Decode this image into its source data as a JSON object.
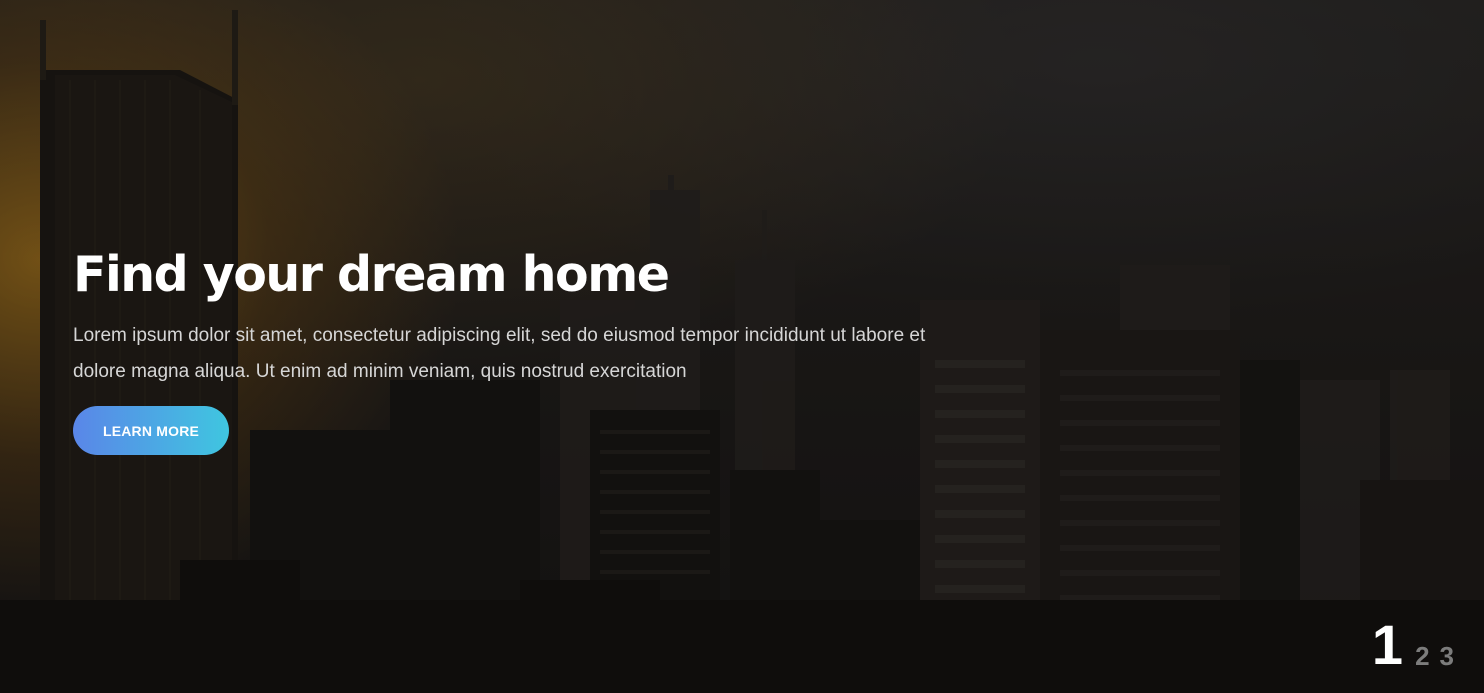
{
  "hero": {
    "title": "Find your dream home",
    "lead": "Lorem ipsum dolor sit amet, consectetur adipiscing elit, sed do eiusmod tempor incididunt ut labore et dolore magna aliqua. Ut enim ad minim veniam, quis nostrud exercitation",
    "cta_label": "LEARN MORE",
    "background_image": "city-skyline-at-sunset"
  },
  "pagination": {
    "pages": [
      "1",
      "2",
      "3"
    ],
    "active_index": 0
  },
  "colors": {
    "cta_gradient_start": "#5a86e8",
    "cta_gradient_end": "#3fc6e0",
    "title": "#ffffff",
    "lead": "#d6d6d6",
    "inactive_page": "#7c7c7c"
  }
}
